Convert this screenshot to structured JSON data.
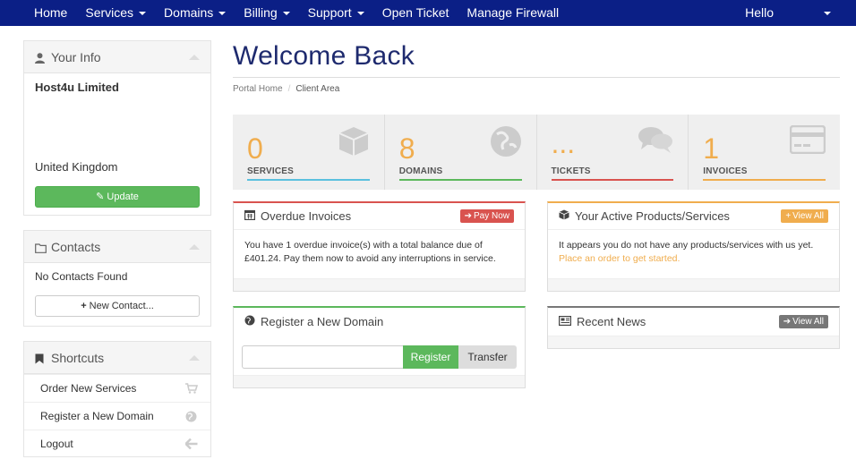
{
  "nav": {
    "items": [
      {
        "label": "Home",
        "dropdown": false
      },
      {
        "label": "Services",
        "dropdown": true
      },
      {
        "label": "Domains",
        "dropdown": true
      },
      {
        "label": "Billing",
        "dropdown": true
      },
      {
        "label": "Support",
        "dropdown": true
      },
      {
        "label": "Open Ticket",
        "dropdown": false
      },
      {
        "label": "Manage Firewall",
        "dropdown": false
      }
    ],
    "user_label": "Hello"
  },
  "sidebar": {
    "your_info": {
      "title": "Your Info",
      "company": "Host4u Limited",
      "country": "United Kingdom",
      "update_label": "Update"
    },
    "contacts": {
      "title": "Contacts",
      "empty_text": "No Contacts Found",
      "new_contact_label": "New Contact..."
    },
    "shortcuts": {
      "title": "Shortcuts",
      "items": [
        {
          "label": "Order New Services",
          "icon": "cart-icon"
        },
        {
          "label": "Register a New Domain",
          "icon": "globe-icon"
        },
        {
          "label": "Logout",
          "icon": "arrow-left-icon"
        }
      ]
    }
  },
  "main": {
    "title": "Welcome Back",
    "breadcrumb": [
      "Portal Home",
      "Client Area"
    ],
    "stats": [
      {
        "value": "0",
        "label": "SERVICES",
        "color": "#5bc0de",
        "icon": "cube-icon"
      },
      {
        "value": "8",
        "label": "DOMAINS",
        "color": "#5cb85c",
        "icon": "globe-icon"
      },
      {
        "value": "...",
        "label": "TICKETS",
        "color": "#d9534f",
        "icon": "comments-icon"
      },
      {
        "value": "1",
        "label": "INVOICES",
        "color": "#f0ad4e",
        "icon": "credit-card-icon"
      }
    ],
    "overdue": {
      "title": "Overdue Invoices",
      "button": "Pay Now",
      "text": "You have 1 overdue invoice(s) with a total balance due of £401.24. Pay them now to avoid any interruptions in service."
    },
    "products": {
      "title": "Your Active Products/Services",
      "button": "View All",
      "text": "It appears you do not have any products/services with us yet.",
      "link": "Place an order to get started."
    },
    "register": {
      "title": "Register a New Domain",
      "register_label": "Register",
      "transfer_label": "Transfer"
    },
    "news": {
      "title": "Recent News",
      "button": "View All"
    }
  },
  "colors": {
    "nav_bg": "#0b1f86",
    "accent_orange": "#f0ad4e",
    "success": "#5cb85c",
    "danger": "#d9534f",
    "info": "#5bc0de"
  }
}
